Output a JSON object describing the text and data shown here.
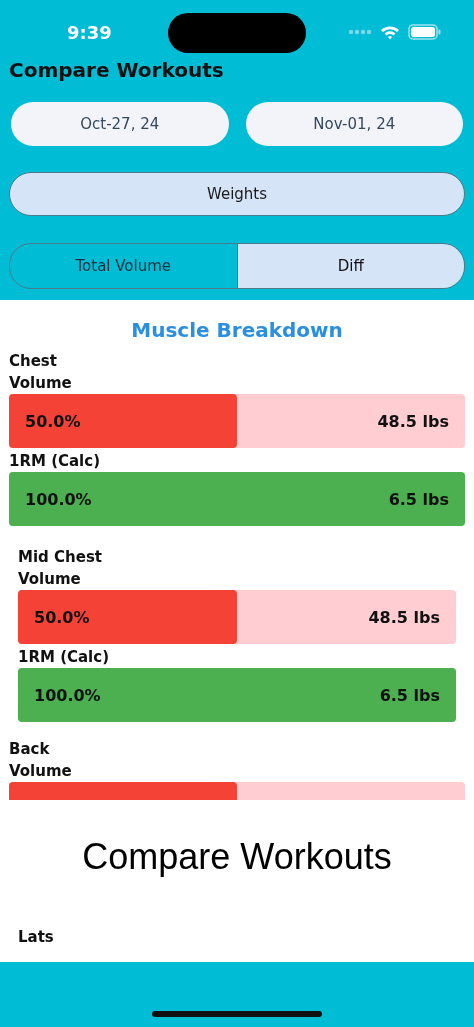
{
  "status_bar": {
    "time": "9:39"
  },
  "title": "Compare Workouts",
  "date_range": [
    {
      "label": "Oct-27, 24"
    },
    {
      "label": "Nov-01, 24"
    }
  ],
  "category": {
    "label": "Weights"
  },
  "tabs": [
    {
      "label": "Total Volume",
      "selected": false
    },
    {
      "label": "Diff",
      "selected": true
    }
  ],
  "section_title": "Muscle Breakdown",
  "muscles": [
    {
      "name": "Chest",
      "indented": false,
      "metrics": [
        {
          "label": "Volume",
          "kind": "volume",
          "level": 0.5,
          "percent": "50.0%",
          "value": "48.5 lbs"
        },
        {
          "label": "1RM (Calc)",
          "kind": "one_rep_max",
          "level": 1,
          "percent": "100.0%",
          "value": "6.5 lbs"
        }
      ]
    },
    {
      "name": "Mid Chest",
      "indented": true,
      "metrics": [
        {
          "label": "Volume",
          "kind": "volume",
          "level": 0.5,
          "percent": "50.0%",
          "value": "48.5 lbs"
        },
        {
          "label": "1RM (Calc)",
          "kind": "one_rep_max",
          "level": 1,
          "percent": "100.0%",
          "value": "6.5 lbs"
        }
      ]
    },
    {
      "name": "Back",
      "indented": false,
      "metrics": [
        {
          "label": "Volume",
          "kind": "volume",
          "level": 0.5,
          "cut_off": true
        }
      ]
    }
  ],
  "banner": {
    "text": "Compare Workouts"
  },
  "next_muscle": {
    "name": "Lats",
    "indented": true
  }
}
